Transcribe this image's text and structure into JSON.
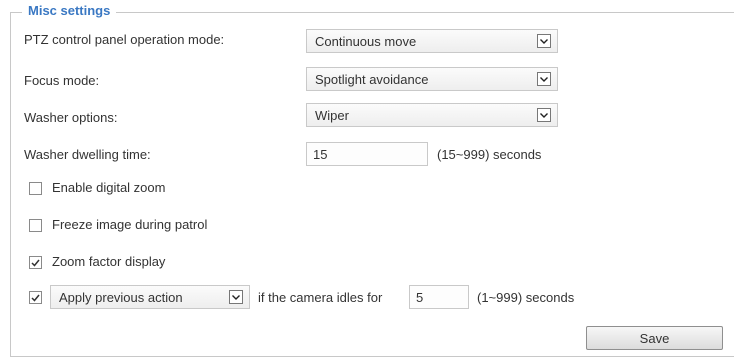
{
  "section": {
    "legend": "Misc settings"
  },
  "ptz_mode": {
    "label": "PTZ control panel operation mode:",
    "value": "Continuous move"
  },
  "focus_mode": {
    "label": "Focus mode:",
    "value": "Spotlight avoidance"
  },
  "washer_options": {
    "label": "Washer options:",
    "value": "Wiper"
  },
  "washer_dwelling": {
    "label": "Washer dwelling time:",
    "value": "15",
    "unit": "(15~999) seconds"
  },
  "digital_zoom": {
    "label": "Enable digital zoom",
    "checked": false
  },
  "freeze_image": {
    "label": "Freeze image during patrol",
    "checked": false
  },
  "zoom_factor": {
    "label": "Zoom factor display",
    "checked": true
  },
  "idle_action": {
    "checked": true,
    "value": "Apply previous action",
    "text": "if the camera idles for",
    "seconds": "5",
    "unit": "(1~999) seconds"
  },
  "save_button": {
    "label": "Save"
  },
  "icons": {
    "dropdown": "chevron-down-icon",
    "check": "checkmark-icon"
  },
  "colors": {
    "legend": "#3a78c3",
    "border": "#c8c8c8"
  }
}
